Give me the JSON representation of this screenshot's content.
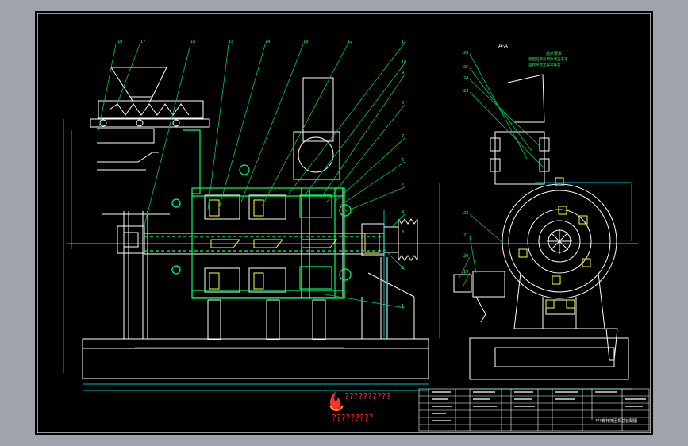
{
  "view_title": "A-A",
  "tech_req": {
    "title": "技术要求",
    "line1": "装配前所有零件清洗干净",
    "line2": "运转平稳无异常噪音"
  },
  "part_numbers_left": [
    "18",
    "17",
    "16",
    "15",
    "14",
    "13",
    "12"
  ],
  "part_numbers_right": [
    "11",
    "10",
    "9",
    "8",
    "7",
    "6",
    "5",
    "4",
    "3",
    "2",
    "1"
  ],
  "side_view_numbers": [
    "26",
    "25",
    "24",
    "23",
    "22",
    "21",
    "20",
    "19"
  ],
  "logo": {
    "top_text": "??????????",
    "bottom_text": "?????????"
  },
  "title_block": {
    "caption": "???螺杆挤压机总装配图"
  },
  "colors": {
    "sheet": "#000000",
    "frame": "#ffffff",
    "outline": "#ffffff",
    "section": "#00ff66",
    "leader": "#00cc44",
    "centerline": "#ffff00",
    "label_yellow": "#ffff33",
    "label_green": "#33ff66",
    "dimension": "#00ffff",
    "logo_red": "#ff2020"
  }
}
